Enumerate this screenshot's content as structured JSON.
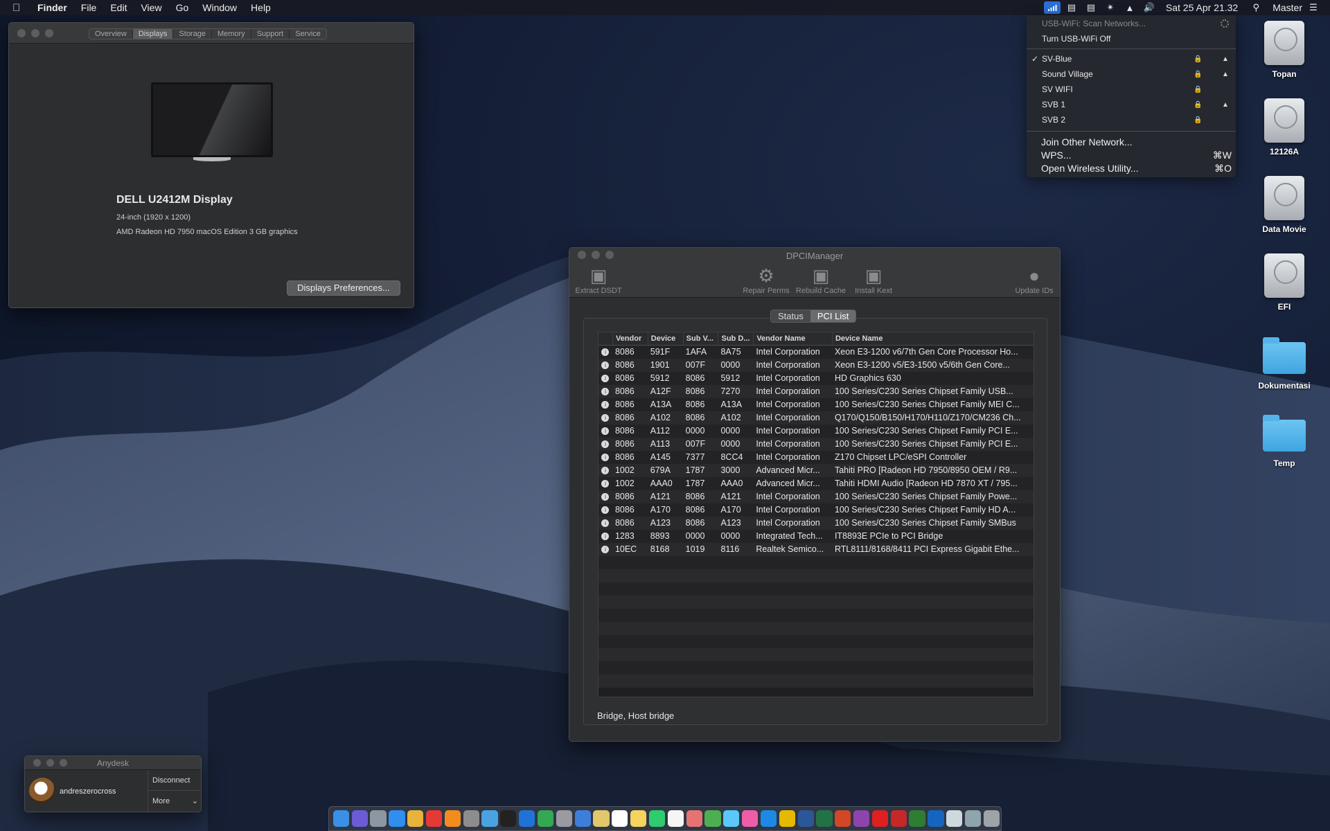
{
  "menubar": {
    "app": "Finder",
    "items": [
      "File",
      "Edit",
      "View",
      "Go",
      "Window",
      "Help"
    ],
    "status_icons": [
      "wifi-icon",
      "stack-icon",
      "activity-icon",
      "bluetooth-icon",
      "airplay-icon",
      "volume-icon"
    ],
    "clock": "Sat 25 Apr  21.32",
    "user": "Master"
  },
  "wifi_menu": {
    "scan": "USB-WiFi: Scan Networks...",
    "toggle": "Turn USB-WiFi Off",
    "networks": [
      {
        "name": "SV-Blue",
        "checked": true,
        "locked": true,
        "signal": true
      },
      {
        "name": "Sound Village",
        "checked": false,
        "locked": true,
        "signal": true
      },
      {
        "name": "SV WIFI",
        "checked": false,
        "locked": true,
        "signal": false
      },
      {
        "name": "SVB 1",
        "checked": false,
        "locked": true,
        "signal": true
      },
      {
        "name": "SVB 2",
        "checked": false,
        "locked": true,
        "signal": false
      }
    ],
    "join_other": "Join Other Network...",
    "wps": "WPS...",
    "wps_shortcut": "⌘W",
    "open_utility": "Open Wireless Utility...",
    "open_utility_shortcut": "⌘O"
  },
  "desktop_icons": [
    {
      "label": "Topan",
      "kind": "disk"
    },
    {
      "label": "12126A",
      "kind": "disk"
    },
    {
      "label": "Data Movie",
      "kind": "disk"
    },
    {
      "label": "EFI",
      "kind": "disk"
    },
    {
      "label": "Dokumentasi",
      "kind": "folder"
    },
    {
      "label": "Temp",
      "kind": "folder"
    }
  ],
  "about": {
    "tabs": [
      "Overview",
      "Displays",
      "Storage",
      "Memory",
      "Support",
      "Service"
    ],
    "selected_tab": "Displays",
    "display_name": "DELL U2412M Display",
    "display_size": "24-inch (1920 x 1200)",
    "graphics": "AMD Radeon HD 7950 macOS Edition 3 GB graphics",
    "prefs_button": "Displays Preferences..."
  },
  "dpci": {
    "title": "DPCIManager",
    "toolbar": {
      "extract": "Extract DSDT",
      "repair": "Repair Perms",
      "rebuild": "Rebuild Cache",
      "install": "Install Kext",
      "update": "Update IDs"
    },
    "segments": [
      "Status",
      "PCI List"
    ],
    "selected_segment": "PCI List",
    "columns": [
      "Vendor",
      "Device",
      "Sub V...",
      "Sub D...",
      "Vendor Name",
      "Device Name"
    ],
    "rows": [
      [
        "8086",
        "591F",
        "1AFA",
        "8A75",
        "Intel Corporation",
        "Xeon E3-1200 v6/7th Gen Core Processor Ho..."
      ],
      [
        "8086",
        "1901",
        "007F",
        "0000",
        "Intel Corporation",
        "Xeon E3-1200 v5/E3-1500 v5/6th Gen Core..."
      ],
      [
        "8086",
        "5912",
        "8086",
        "5912",
        "Intel Corporation",
        "HD Graphics 630"
      ],
      [
        "8086",
        "A12F",
        "8086",
        "7270",
        "Intel Corporation",
        "100 Series/C230 Series Chipset Family USB..."
      ],
      [
        "8086",
        "A13A",
        "8086",
        "A13A",
        "Intel Corporation",
        "100 Series/C230 Series Chipset Family MEI C..."
      ],
      [
        "8086",
        "A102",
        "8086",
        "A102",
        "Intel Corporation",
        "Q170/Q150/B150/H170/H110/Z170/CM236 Ch..."
      ],
      [
        "8086",
        "A112",
        "0000",
        "0000",
        "Intel Corporation",
        "100 Series/C230 Series Chipset Family PCI E..."
      ],
      [
        "8086",
        "A113",
        "007F",
        "0000",
        "Intel Corporation",
        "100 Series/C230 Series Chipset Family PCI E..."
      ],
      [
        "8086",
        "A145",
        "7377",
        "8CC4",
        "Intel Corporation",
        "Z170 Chipset LPC/eSPI Controller"
      ],
      [
        "1002",
        "679A",
        "1787",
        "3000",
        "Advanced Micr...",
        "Tahiti PRO [Radeon HD 7950/8950 OEM / R9..."
      ],
      [
        "1002",
        "AAA0",
        "1787",
        "AAA0",
        "Advanced Micr...",
        "Tahiti HDMI Audio [Radeon HD 7870 XT / 795..."
      ],
      [
        "8086",
        "A121",
        "8086",
        "A121",
        "Intel Corporation",
        "100 Series/C230 Series Chipset Family Powe..."
      ],
      [
        "8086",
        "A170",
        "8086",
        "A170",
        "Intel Corporation",
        "100 Series/C230 Series Chipset Family HD A..."
      ],
      [
        "8086",
        "A123",
        "8086",
        "A123",
        "Intel Corporation",
        "100 Series/C230 Series Chipset Family SMBus"
      ],
      [
        "1283",
        "8893",
        "0000",
        "0000",
        "Integrated Tech...",
        "IT8893E PCIe to PCI Bridge"
      ],
      [
        "10EC",
        "8168",
        "1019",
        "8116",
        "Realtek Semico...",
        "RTL8111/8168/8411 PCI Express Gigabit Ethe..."
      ]
    ],
    "status_text": "Bridge, Host bridge"
  },
  "anydesk": {
    "title": "Anydesk",
    "user": "andreszerocross",
    "disconnect": "Disconnect",
    "more": "More"
  },
  "dock": {
    "apps": [
      "finder-icon",
      "siri-icon",
      "launchpad-icon",
      "safari-icon",
      "chrome-icon",
      "youtube-icon",
      "vlc-icon",
      "settings-icon",
      "preview-icon",
      "terminal-icon",
      "teamviewer-icon",
      "globe-icon",
      "installer-icon",
      "xcode-icon",
      "notes-icon",
      "calendar-icon",
      "notepad-icon",
      "facetime-icon",
      "textedit-icon",
      "photos-icon",
      "chrome2-icon",
      "messages-icon",
      "music-icon",
      "appstore-icon",
      "tools-icon",
      "word-icon",
      "excel-icon",
      "powerpoint-icon",
      "podcast-icon",
      "acrobat-icon",
      "trash-dock-icon",
      "photo-icon",
      "network-icon",
      "script-icon",
      "file-icon",
      "trash-icon"
    ],
    "colors": [
      "#3a8fe6",
      "#6c5bd6",
      "#8d96a3",
      "#2f8ef0",
      "#e8b33a",
      "#e53935",
      "#f28c1c",
      "#8d8d8d",
      "#4aa3e0",
      "#222222",
      "#1f73d6",
      "#34a853",
      "#9a9aa0",
      "#3d7edb",
      "#e2c76c",
      "#ffffff",
      "#f4d35e",
      "#2ecc71",
      "#f5f5f5",
      "#e57373",
      "#4caf50",
      "#5ac8fa",
      "#ef5da8",
      "#1e88e5",
      "#e6b800",
      "#2b579a",
      "#217346",
      "#d24726",
      "#8e44ad",
      "#e02020",
      "#c62828",
      "#2e7d32",
      "#1565c0",
      "#cfd8dc",
      "#90a4ae",
      "#9ea3a8"
    ]
  }
}
